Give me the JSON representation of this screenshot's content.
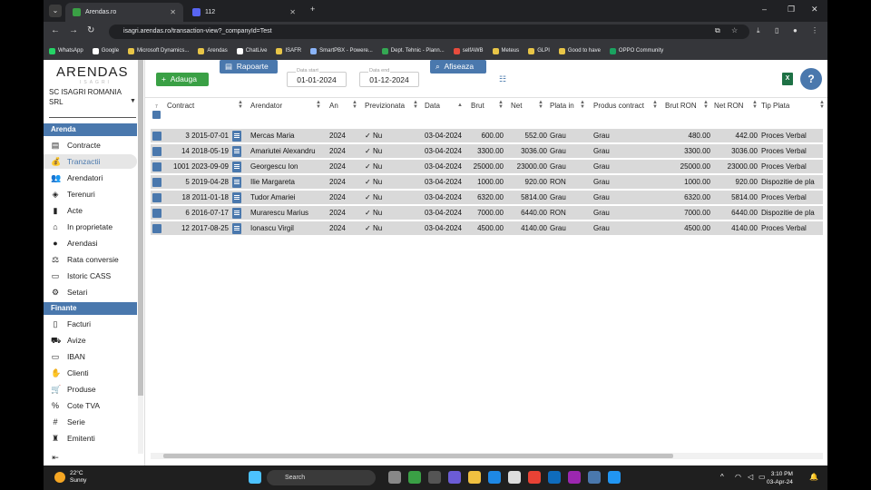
{
  "browser": {
    "tabs": [
      {
        "label": "Arendas.ro",
        "active": true
      },
      {
        "label": "112",
        "active": false
      }
    ],
    "url": "isagri.arendas.ro/transaction-view?_companyId=Test",
    "bookmarks": [
      "WhatsApp",
      "Google",
      "Microsoft Dynamics...",
      "Arendas",
      "ChatLive",
      "ISAFR",
      "SmartPBX - Powere...",
      "Dept. Tehnic - Plann...",
      "selfAWB",
      "Meteus",
      "GLPI",
      "Good to have",
      "OPPO Community"
    ]
  },
  "sidebar": {
    "logo": "ARENDAS",
    "logo_sub": "ISAGRI",
    "company": "SC ISAGRI ROMANIA SRL",
    "sections": [
      {
        "title": "Arenda",
        "items": [
          {
            "label": "Contracte",
            "icon": "clipboard-icon"
          },
          {
            "label": "Tranzactii",
            "icon": "money-bag-icon",
            "active": true
          },
          {
            "label": "Arendatori",
            "icon": "people-icon"
          },
          {
            "label": "Terenuri",
            "icon": "layers-icon"
          },
          {
            "label": "Acte",
            "icon": "document-icon"
          },
          {
            "label": "In proprietate",
            "icon": "home-icon"
          },
          {
            "label": "Arendasi",
            "icon": "person-icon"
          },
          {
            "label": "Rata conversie",
            "icon": "scale-icon"
          },
          {
            "label": "Istoric CASS",
            "icon": "card-icon"
          },
          {
            "label": "Setari",
            "icon": "gear-icon"
          }
        ]
      },
      {
        "title": "Finante",
        "items": [
          {
            "label": "Facturi",
            "icon": "invoice-icon"
          },
          {
            "label": "Avize",
            "icon": "truck-icon"
          },
          {
            "label": "IBAN",
            "icon": "bank-card-icon"
          },
          {
            "label": "Clienti",
            "icon": "handshake-icon"
          },
          {
            "label": "Produse",
            "icon": "cart-icon"
          },
          {
            "label": "Cote TVA",
            "icon": "percent-icon"
          },
          {
            "label": "Serie",
            "icon": "hash-icon"
          },
          {
            "label": "Emitenti",
            "icon": "stamp-icon"
          }
        ]
      }
    ]
  },
  "toolbar": {
    "add_label": "Adauga",
    "reports_label": "Rapoarte",
    "date_start_label": "Data start",
    "date_start": "01-01-2024",
    "date_end_label": "Data end",
    "date_end": "01-12-2024",
    "show_label": "Afiseaza"
  },
  "grid": {
    "header_number": "7",
    "columns": [
      "Contract",
      "Arendator",
      "An",
      "Previzionata",
      "Data",
      "Brut",
      "Net",
      "Plata in",
      "Produs contract",
      "Brut RON",
      "Net RON",
      "Tip Plata"
    ],
    "rows": [
      {
        "contract": "3 2015-07-01",
        "arendator": "Mercas Maria",
        "an": "2024",
        "previzionata": "Nu",
        "data": "03-04-2024",
        "brut": "600.00",
        "net": "552.00",
        "plata_in": "Grau",
        "produs": "Grau",
        "brut_ron": "480.00",
        "net_ron": "442.00",
        "tip_plata": "Proces Verbal"
      },
      {
        "contract": "14 2018-05-19",
        "arendator": "Amariutei Alexandru",
        "an": "2024",
        "previzionata": "Nu",
        "data": "03-04-2024",
        "brut": "3300.00",
        "net": "3036.00",
        "plata_in": "Grau",
        "produs": "Grau",
        "brut_ron": "3300.00",
        "net_ron": "3036.00",
        "tip_plata": "Proces Verbal"
      },
      {
        "contract": "1001 2023-09-09",
        "arendator": "Georgescu Ion",
        "an": "2024",
        "previzionata": "Nu",
        "data": "03-04-2024",
        "brut": "25000.00",
        "net": "23000.00",
        "plata_in": "Grau",
        "produs": "Grau",
        "brut_ron": "25000.00",
        "net_ron": "23000.00",
        "tip_plata": "Proces Verbal"
      },
      {
        "contract": "5 2019-04-28",
        "arendator": "Ilie Margareta",
        "an": "2024",
        "previzionata": "Nu",
        "data": "03-04-2024",
        "brut": "1000.00",
        "net": "920.00",
        "plata_in": "RON",
        "produs": "Grau",
        "brut_ron": "1000.00",
        "net_ron": "920.00",
        "tip_plata": "Dispozitie de pla"
      },
      {
        "contract": "18 2011-01-18",
        "arendator": "Tudor Amariei",
        "an": "2024",
        "previzionata": "Nu",
        "data": "03-04-2024",
        "brut": "6320.00",
        "net": "5814.00",
        "plata_in": "Grau",
        "produs": "Grau",
        "brut_ron": "6320.00",
        "net_ron": "5814.00",
        "tip_plata": "Proces Verbal"
      },
      {
        "contract": "6 2016-07-17",
        "arendator": "Murarescu Marius",
        "an": "2024",
        "previzionata": "Nu",
        "data": "03-04-2024",
        "brut": "7000.00",
        "net": "6440.00",
        "plata_in": "RON",
        "produs": "Grau",
        "brut_ron": "7000.00",
        "net_ron": "6440.00",
        "tip_plata": "Dispozitie de pla"
      },
      {
        "contract": "12 2017-08-25",
        "arendator": "Ionascu Virgil",
        "an": "2024",
        "previzionata": "Nu",
        "data": "03-04-2024",
        "brut": "4500.00",
        "net": "4140.00",
        "plata_in": "Grau",
        "produs": "Grau",
        "brut_ron": "4500.00",
        "net_ron": "4140.00",
        "tip_plata": "Proces Verbal"
      }
    ]
  },
  "taskbar": {
    "temperature": "22°C",
    "weather": "Sunny",
    "search": "Search",
    "time": "3:10 PM",
    "date": "03-Apr-24"
  },
  "colors": {
    "accent": "#4a78ad",
    "add_button": "#3aa045",
    "row_bg": "#d9d9d9"
  }
}
